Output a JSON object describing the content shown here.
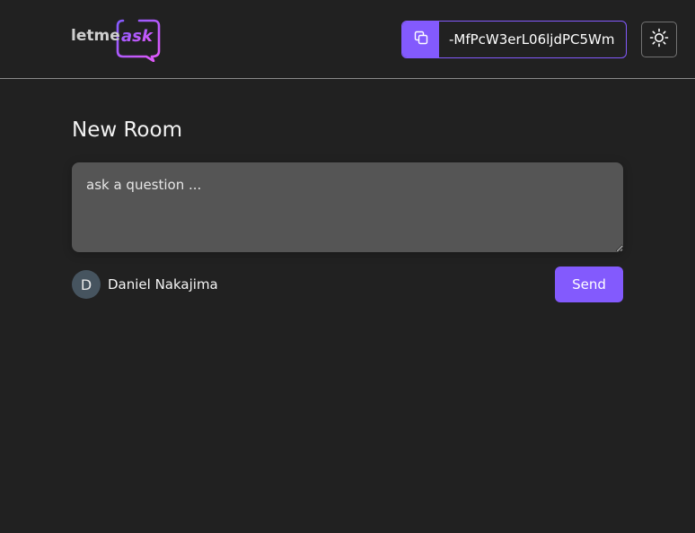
{
  "header": {
    "logo": {
      "text_plain": "letme",
      "text_accent": "ask",
      "icon": "speech-bubble-logo"
    },
    "room_code": {
      "value": "-MfPcW3erL06ljdPC5Wm",
      "icon": "copy-icon"
    },
    "theme_toggle": {
      "icon": "sun-icon"
    }
  },
  "main": {
    "title": "New Room",
    "question": {
      "value": "",
      "placeholder": "ask a question ..."
    },
    "user": {
      "avatar_initial": "D",
      "name": "Daniel Nakajima"
    },
    "send_label": "Send"
  },
  "colors": {
    "background": "#212121",
    "accent": "#835afd",
    "logo_gradient_end": "#e559f9",
    "input_bg": "#555555",
    "avatar_bg": "#46545f"
  }
}
